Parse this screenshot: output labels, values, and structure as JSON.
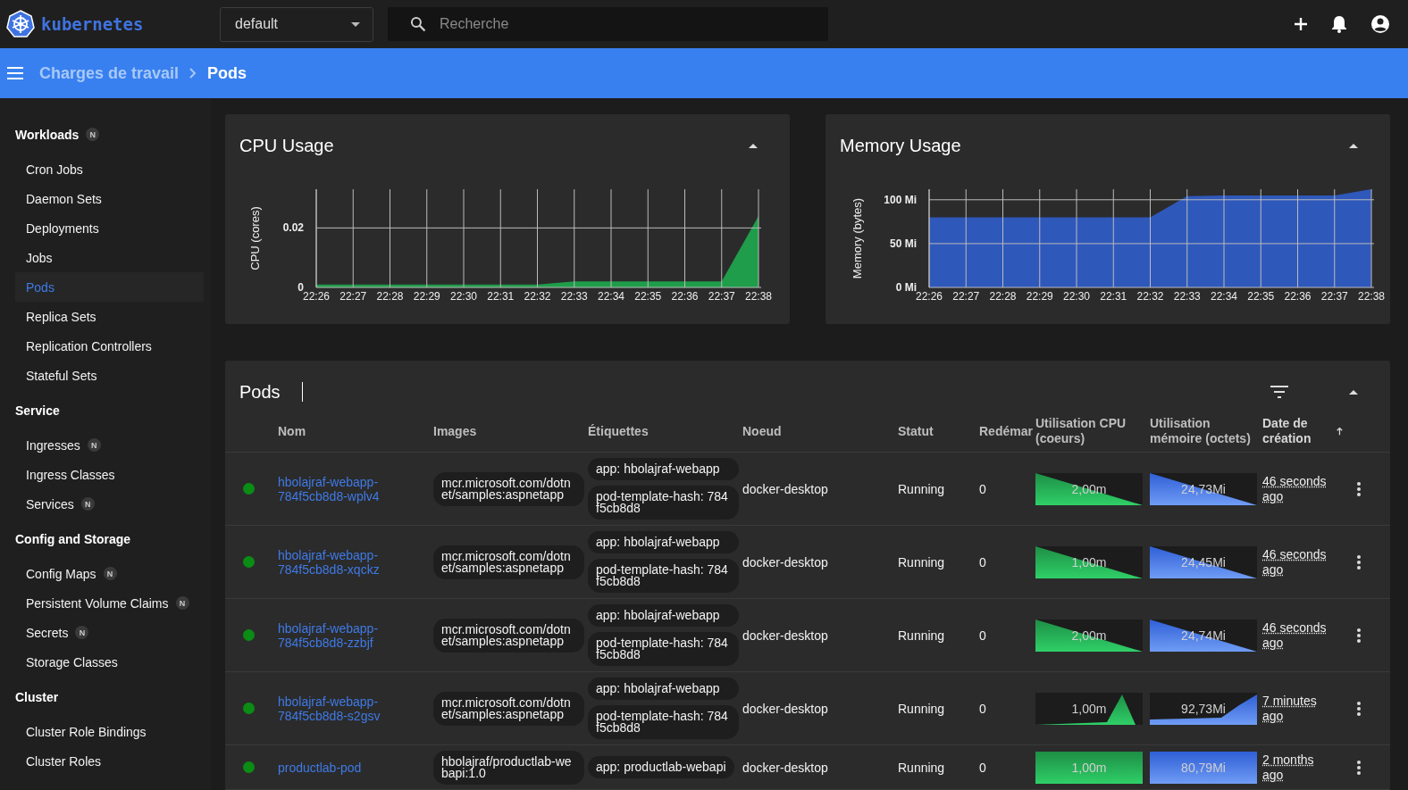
{
  "top_bar": {
    "logo_text": "kubernetes",
    "namespace": "default",
    "search": {
      "placeholder": "Recherche"
    }
  },
  "breadcrumb": [
    {
      "label": "Charges de travail",
      "current": false
    },
    {
      "label": "Pods",
      "current": true
    }
  ],
  "sidebar": {
    "sections": [
      {
        "title": "Workloads",
        "badge": "N",
        "items": [
          {
            "label": "Cron Jobs",
            "selected": false
          },
          {
            "label": "Daemon Sets",
            "selected": false
          },
          {
            "label": "Deployments",
            "selected": false
          },
          {
            "label": "Jobs",
            "selected": false
          },
          {
            "label": "Pods",
            "selected": true
          },
          {
            "label": "Replica Sets",
            "selected": false
          },
          {
            "label": "Replication Controllers",
            "selected": false
          },
          {
            "label": "Stateful Sets",
            "selected": false
          }
        ]
      },
      {
        "title": "Service",
        "items": [
          {
            "label": "Ingresses",
            "badge": "N",
            "selected": false
          },
          {
            "label": "Ingress Classes",
            "selected": false
          },
          {
            "label": "Services",
            "badge": "N",
            "selected": false
          }
        ]
      },
      {
        "title": "Config and Storage",
        "items": [
          {
            "label": "Config Maps",
            "badge": "N",
            "selected": false
          },
          {
            "label": "Persistent Volume Claims",
            "badge": "N",
            "selected": false
          },
          {
            "label": "Secrets",
            "badge": "N",
            "selected": false
          },
          {
            "label": "Storage Classes",
            "selected": false
          }
        ]
      },
      {
        "title": "Cluster",
        "items": [
          {
            "label": "Cluster Role Bindings",
            "selected": false
          },
          {
            "label": "Cluster Roles",
            "selected": false
          }
        ]
      }
    ]
  },
  "cpu_card": {
    "title": "CPU Usage",
    "chart_data": {
      "type": "area",
      "ylabel": "CPU (cores)",
      "categories": [
        "22:26",
        "22:27",
        "22:28",
        "22:29",
        "22:30",
        "22:31",
        "22:32",
        "22:33",
        "22:34",
        "22:35",
        "22:36",
        "22:37",
        "22:38"
      ],
      "grid": true,
      "series": [
        {
          "color": "#1f9d4a",
          "values": [
            0.001,
            0.001,
            0.001,
            0.001,
            0.001,
            0.001,
            0.001,
            0.002,
            0.002,
            0.002,
            0.002,
            0.002,
            0.024
          ]
        }
      ],
      "ylim": [
        0,
        0.033
      ],
      "yticks": [
        0,
        0.02
      ]
    }
  },
  "memory_card": {
    "title": "Memory Usage",
    "chart_data": {
      "type": "area",
      "ylabel": "Memory (bytes)",
      "categories": [
        "22:26",
        "22:27",
        "22:28",
        "22:29",
        "22:30",
        "22:31",
        "22:32",
        "22:33",
        "22:34",
        "22:35",
        "22:36",
        "22:37",
        "22:38"
      ],
      "grid": true,
      "series": [
        {
          "color": "#2f58bb",
          "values": [
            80,
            80,
            80,
            80,
            80,
            80,
            80,
            104,
            105,
            105,
            105,
            105,
            112
          ]
        }
      ],
      "ylim": [
        0,
        112
      ],
      "yticks": [
        {
          "value": 0,
          "label": "0 Mi"
        },
        {
          "value": 50,
          "label": "50 Mi"
        },
        {
          "value": 100,
          "label": "100 Mi"
        }
      ]
    }
  },
  "pods": {
    "title": "Pods",
    "columns": [
      {
        "label": "Nom",
        "sorted": false
      },
      {
        "label": "Images",
        "sorted": false
      },
      {
        "label": "Étiquettes",
        "sorted": false
      },
      {
        "label": "Noeud",
        "sorted": false
      },
      {
        "label": "Statut",
        "sorted": false
      },
      {
        "label": "Redémar",
        "sorted": false
      },
      {
        "label": "Utilisation CPU (coeurs)",
        "sorted": false
      },
      {
        "label": "Utilisation mémoire (octets)",
        "sorted": false
      },
      {
        "label": "Date de création",
        "sorted": true
      }
    ],
    "rows": [
      {
        "color": "#0b8c15",
        "name": "hbolajraf-webapp-784f5cb8d8-wplv4",
        "images": [
          "mcr.microsoft.com/dotnet/samples:aspnetapp"
        ],
        "labels": [
          "app: hbolajraf-webapp",
          "pod-template-hash: 784f5cb8d8"
        ],
        "node": "docker-desktop",
        "status": "Running",
        "restarts": "0",
        "cpu": {
          "value": "2,00m",
          "kind": "falling"
        },
        "memory": {
          "value": "24,73Mi",
          "kind": "falling"
        },
        "created": "46 seconds ago"
      },
      {
        "color": "#0b8c15",
        "name": "hbolajraf-webapp-784f5cb8d8-xqckz",
        "images": [
          "mcr.microsoft.com/dotnet/samples:aspnetapp"
        ],
        "labels": [
          "app: hbolajraf-webapp",
          "pod-template-hash: 784f5cb8d8"
        ],
        "node": "docker-desktop",
        "status": "Running",
        "restarts": "0",
        "cpu": {
          "value": "1,00m",
          "kind": "falling"
        },
        "memory": {
          "value": "24,45Mi",
          "kind": "falling"
        },
        "created": "46 seconds ago"
      },
      {
        "color": "#0b8c15",
        "name": "hbolajraf-webapp-784f5cb8d8-zzbjf",
        "images": [
          "mcr.microsoft.com/dotnet/samples:aspnetapp"
        ],
        "labels": [
          "app: hbolajraf-webapp",
          "pod-template-hash: 784f5cb8d8"
        ],
        "node": "docker-desktop",
        "status": "Running",
        "restarts": "0",
        "cpu": {
          "value": "2,00m",
          "kind": "falling"
        },
        "memory": {
          "value": "24,74Mi",
          "kind": "falling"
        },
        "created": "46 seconds ago"
      },
      {
        "color": "#0b8c15",
        "name": "hbolajraf-webapp-784f5cb8d8-s2gsv",
        "images": [
          "mcr.microsoft.com/dotnet/samples:aspnetapp"
        ],
        "labels": [
          "app: hbolajraf-webapp",
          "pod-template-hash: 784f5cb8d8"
        ],
        "node": "docker-desktop",
        "status": "Running",
        "restarts": "0",
        "cpu": {
          "value": "1,00m",
          "kind": "spike"
        },
        "memory": {
          "value": "92,73Mi",
          "kind": "rising"
        },
        "created": "7 minutes ago"
      },
      {
        "color": "#0b8c15",
        "name": "productlab-pod",
        "images": [
          "hbolajraf/productlab-webapi:1.0"
        ],
        "labels": [
          "app: productlab-webapi"
        ],
        "node": "docker-desktop",
        "status": "Running",
        "restarts": "0",
        "cpu": {
          "value": "1,00m",
          "kind": "flat"
        },
        "memory": {
          "value": "80,79Mi",
          "kind": "flat"
        },
        "created": "2 months ago"
      }
    ]
  }
}
